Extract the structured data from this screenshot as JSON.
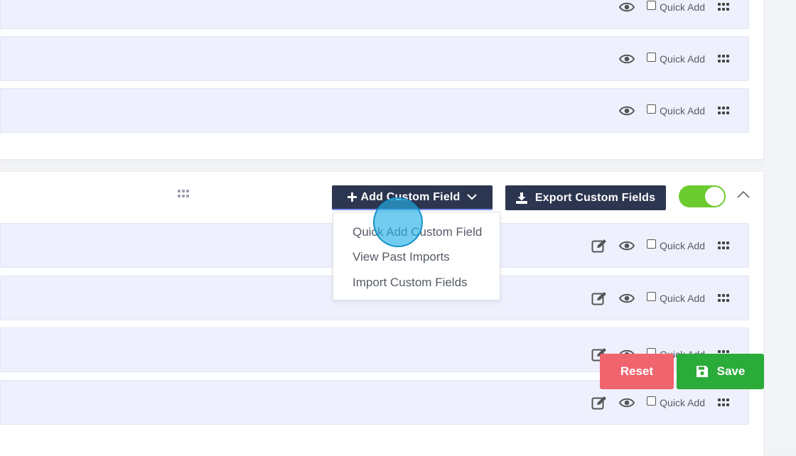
{
  "rows": {
    "quick_add_label": "Quick Add"
  },
  "section": {
    "add_custom_field_label": "Add Custom Field",
    "export_custom_fields_label": "Export Custom Fields",
    "enabled": true
  },
  "dropdown": {
    "items": [
      {
        "label": "Quick Add Custom Field"
      },
      {
        "label": "View Past Imports"
      },
      {
        "label": "Import Custom Fields"
      }
    ]
  },
  "footer": {
    "reset_label": "Reset",
    "save_label": "Save"
  },
  "colors": {
    "primary_dark": "#2c3650",
    "toggle_on": "#6ccb2e",
    "reset": "#f0646e",
    "save": "#2bab3a",
    "row_bg": "#eef1fd"
  },
  "icons": [
    "edit-icon",
    "eye-icon",
    "drag-handle-icon",
    "plus-icon",
    "chevron-down-icon",
    "download-icon",
    "chevron-up-icon",
    "floppy-disk-icon"
  ]
}
